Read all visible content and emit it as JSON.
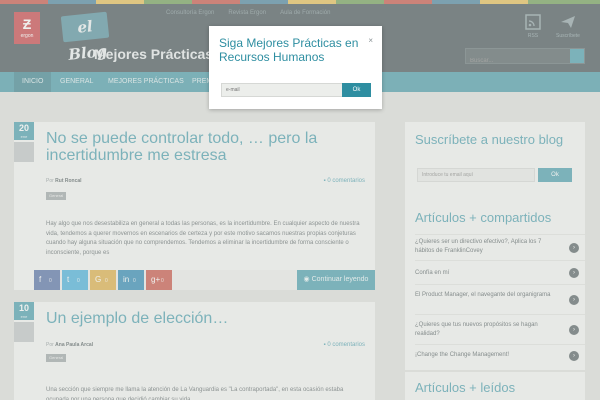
{
  "header": {
    "logo_text": "ergon",
    "blog_badge": "el Blog",
    "site_title": "Mejores Prácticas en Recursos Humanos",
    "top_links": [
      "Consultoría Ergon",
      "Revista Ergon",
      "Aula de Formación"
    ],
    "rss_label": "RSS",
    "newsletter_label": "Suscríbete",
    "search_placeholder": "Buscar..."
  },
  "nav": {
    "items": [
      "INICIO",
      "GENERAL",
      "MEJORES PRÁCTICAS",
      "PREMIOS"
    ]
  },
  "modal": {
    "title": "Siga Mejores Prácticas en Recursos Humanos",
    "close": "×",
    "email_placeholder": "e-mail",
    "ok_label": "Ok"
  },
  "posts": [
    {
      "day": "20",
      "month": "ene",
      "title": "No se puede controlar todo, … pero la incertidumbre me estresa",
      "by": "Por",
      "author": "Rut Roncal",
      "comments": "0 comentarios",
      "tag": "General",
      "excerpt": "Hay algo que nos desestabiliza en general a todas las personas, es la incertidumbre. En cualquier aspecto de nuestra vida, tendemos a querer movernos en escenarios de certeza y por este motivo sacamos nuestras propias conjeturas cuando hay alguna situación que no comprendemos. Tendemos a eliminar la incertidumbre de forma consciente o inconsciente, porque es",
      "shares": [
        {
          "icon": "f",
          "count": "0",
          "color": "#3b5998"
        },
        {
          "icon": "t",
          "count": "0",
          "color": "#2ba3d6"
        },
        {
          "icon": "G",
          "count": "0",
          "color": "#d8a12a"
        },
        {
          "icon": "in",
          "count": "0",
          "color": "#0e76a8"
        },
        {
          "icon": "g+",
          "count": "0",
          "color": "#c0392b"
        }
      ],
      "read_more": "Continuar leyendo"
    },
    {
      "day": "10",
      "month": "ene",
      "title": "Un ejemplo de elección…",
      "by": "Por",
      "author": "Ana Paula Arcal",
      "comments": "0 comentarios",
      "tag": "General",
      "excerpt": "Una sección que siempre me llama la atención de La Vanguardia es \"La contraportada\", en esta ocasión estaba ocupada por una persona que decidió cambiar su vida"
    }
  ],
  "sidebar": {
    "subscribe_title": "Suscríbete a nuestro blog",
    "subscribe_placeholder": "Introduce tu email aquí",
    "subscribe_button": "Ok",
    "shared_title": "Artículos + compartidos",
    "shared_items": [
      "¿Quieres ser un directivo efectivo?, Aplica los 7 hábitos de FranklinCovey",
      "Confía en mí",
      "El Product Manager, el navegante del organigrama",
      "¿Quieres que tus nuevos propósitos se hagan realidad?",
      "¡Change the Change Management!"
    ],
    "read_title": "Artículos + leídos"
  }
}
